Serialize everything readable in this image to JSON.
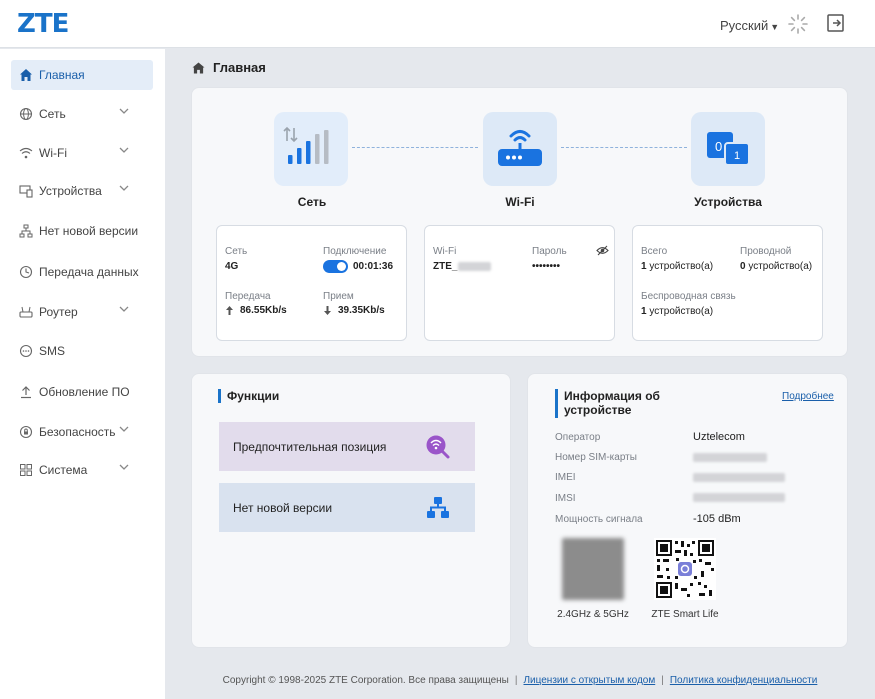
{
  "header": {
    "logo": "ZTE",
    "language": "Русский"
  },
  "sidebar": {
    "items": [
      {
        "label": "Главная",
        "icon": "home-icon",
        "active": true,
        "expandable": false
      },
      {
        "label": "Сеть",
        "icon": "globe-icon",
        "expandable": true
      },
      {
        "label": "Wi-Fi",
        "icon": "wifi-icon",
        "expandable": true
      },
      {
        "label": "Устройства",
        "icon": "devices-icon",
        "expandable": true
      },
      {
        "label": "Нет новой версии",
        "icon": "mesh-icon",
        "expandable": false
      },
      {
        "label": "Передача данных",
        "icon": "clock-icon",
        "expandable": false
      },
      {
        "label": "Роутер",
        "icon": "router-icon",
        "expandable": true
      },
      {
        "label": "SMS",
        "icon": "sms-icon",
        "expandable": false
      },
      {
        "label": "Обновление ПО",
        "icon": "upgrade-icon",
        "expandable": false
      },
      {
        "label": "Безопасность",
        "icon": "shield-icon",
        "expandable": true
      },
      {
        "label": "Система",
        "icon": "grid-icon",
        "expandable": true
      }
    ]
  },
  "main": {
    "title": "Главная",
    "overview": {
      "network": {
        "label": "Сеть",
        "net_label": "Сеть",
        "net_value": "4G",
        "conn_label": "Подключение",
        "conn_time": "00:01:36",
        "upload_label": "Передача",
        "upload_value": "86.55Kb/s",
        "download_label": "Прием",
        "download_value": "39.35Kb/s"
      },
      "wifi": {
        "label": "Wi-Fi",
        "ssid_label": "Wi-Fi",
        "ssid_value": "ZTE_",
        "pass_label": "Пароль",
        "pass_value": "••••••••"
      },
      "devices": {
        "label": "Устройства",
        "total_label": "Всего",
        "total_count": "1",
        "total_unit": "устройство(а)",
        "wired_label": "Проводной",
        "wired_count": "0",
        "wired_unit": "устройство(а)",
        "wireless_label": "Беспроводная связь",
        "wireless_count": "1",
        "wireless_unit": "устройство(а)"
      }
    },
    "functions": {
      "title": "Функции",
      "items": [
        {
          "label": "Предпочтительная позиция",
          "icon": "signal-search-icon",
          "color": "#e2dcec"
        },
        {
          "label": "Нет новой версии",
          "icon": "mesh-network-icon",
          "color": "#d9e2ef"
        }
      ]
    },
    "device_info": {
      "title": "Информация об устройстве",
      "more_link": "Подробнее",
      "rows": [
        {
          "label": "Оператор",
          "value": "Uztelecom"
        },
        {
          "label": "Номер SIM-карты",
          "value": ""
        },
        {
          "label": "IMEI",
          "value": ""
        },
        {
          "label": "IMSI",
          "value": ""
        },
        {
          "label": "Мощность сигнала",
          "value": "-105 dBm"
        }
      ],
      "qr_wifi_caption": "2.4GHz & 5GHz",
      "qr_app_caption": "ZTE Smart Life"
    }
  },
  "footer": {
    "copyright": "Copyright © 1998-2025 ZTE Corporation. Все права защищены",
    "link1": "Лицензии с открытым кодом",
    "link2": "Политика конфиденциальности"
  },
  "colors": {
    "accent": "#1a73c9",
    "active_bg": "#e4edf8",
    "page_bg": "#e5e8ed"
  }
}
